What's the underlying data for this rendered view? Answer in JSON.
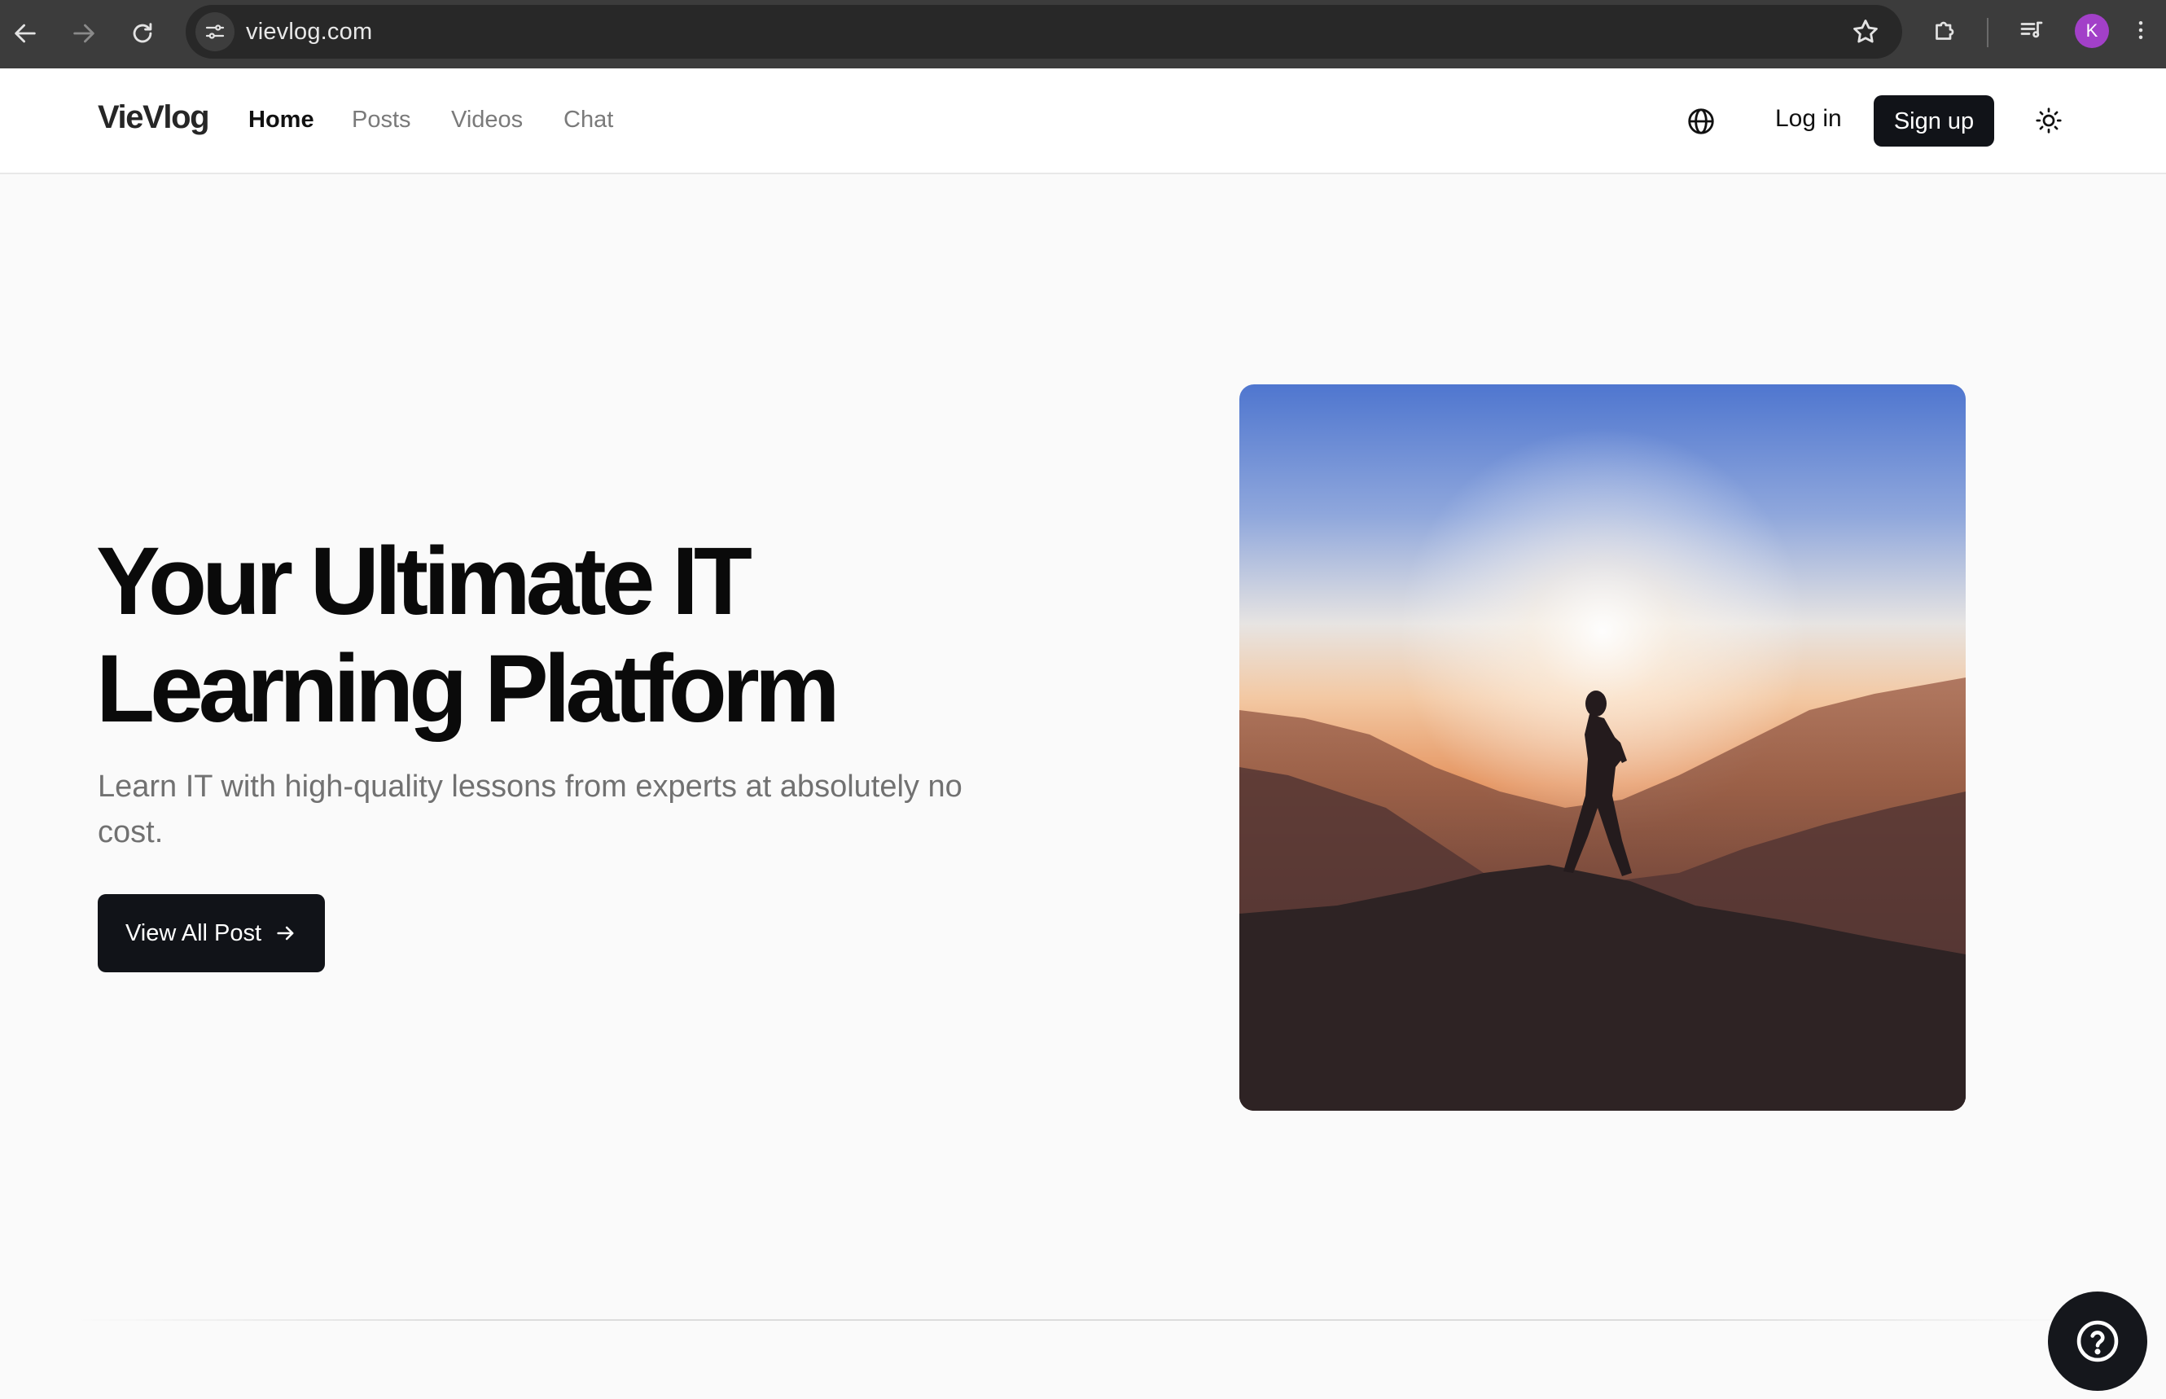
{
  "browser": {
    "url": "vievlog.com",
    "profile_initial": "K",
    "icons": [
      "back-arrow-icon",
      "forward-arrow-icon",
      "reload-icon",
      "site-settings-icon",
      "bookmark-star-icon",
      "extensions-puzzle-icon",
      "media-controls-icon",
      "more-vertical-icon"
    ]
  },
  "header": {
    "logo": "VieVlog",
    "nav": [
      "Home",
      "Posts",
      "Videos",
      "Chat"
    ],
    "active_nav": "Home",
    "login_label": "Log in",
    "signup_label": "Sign up",
    "icons": [
      "globe-icon",
      "sun-icon"
    ]
  },
  "hero": {
    "title_line1": "Your Ultimate IT",
    "title_line2": "Learning Platform",
    "subtitle": "Learn IT with high-quality lessons from experts at absolutely no cost.",
    "cta_label": "View All Post",
    "cta_icon": "arrow-right-icon",
    "image_subject": "silhouette-at-sunset"
  },
  "help": {
    "icon": "question-circle-icon"
  },
  "colors": {
    "chrome_bg": "#3c3c3c",
    "omnibox_bg": "#282828",
    "page_bg": "#fafafa",
    "primary_dark": "#111318",
    "muted_text": "#717171",
    "avatar": "#a240c8"
  }
}
